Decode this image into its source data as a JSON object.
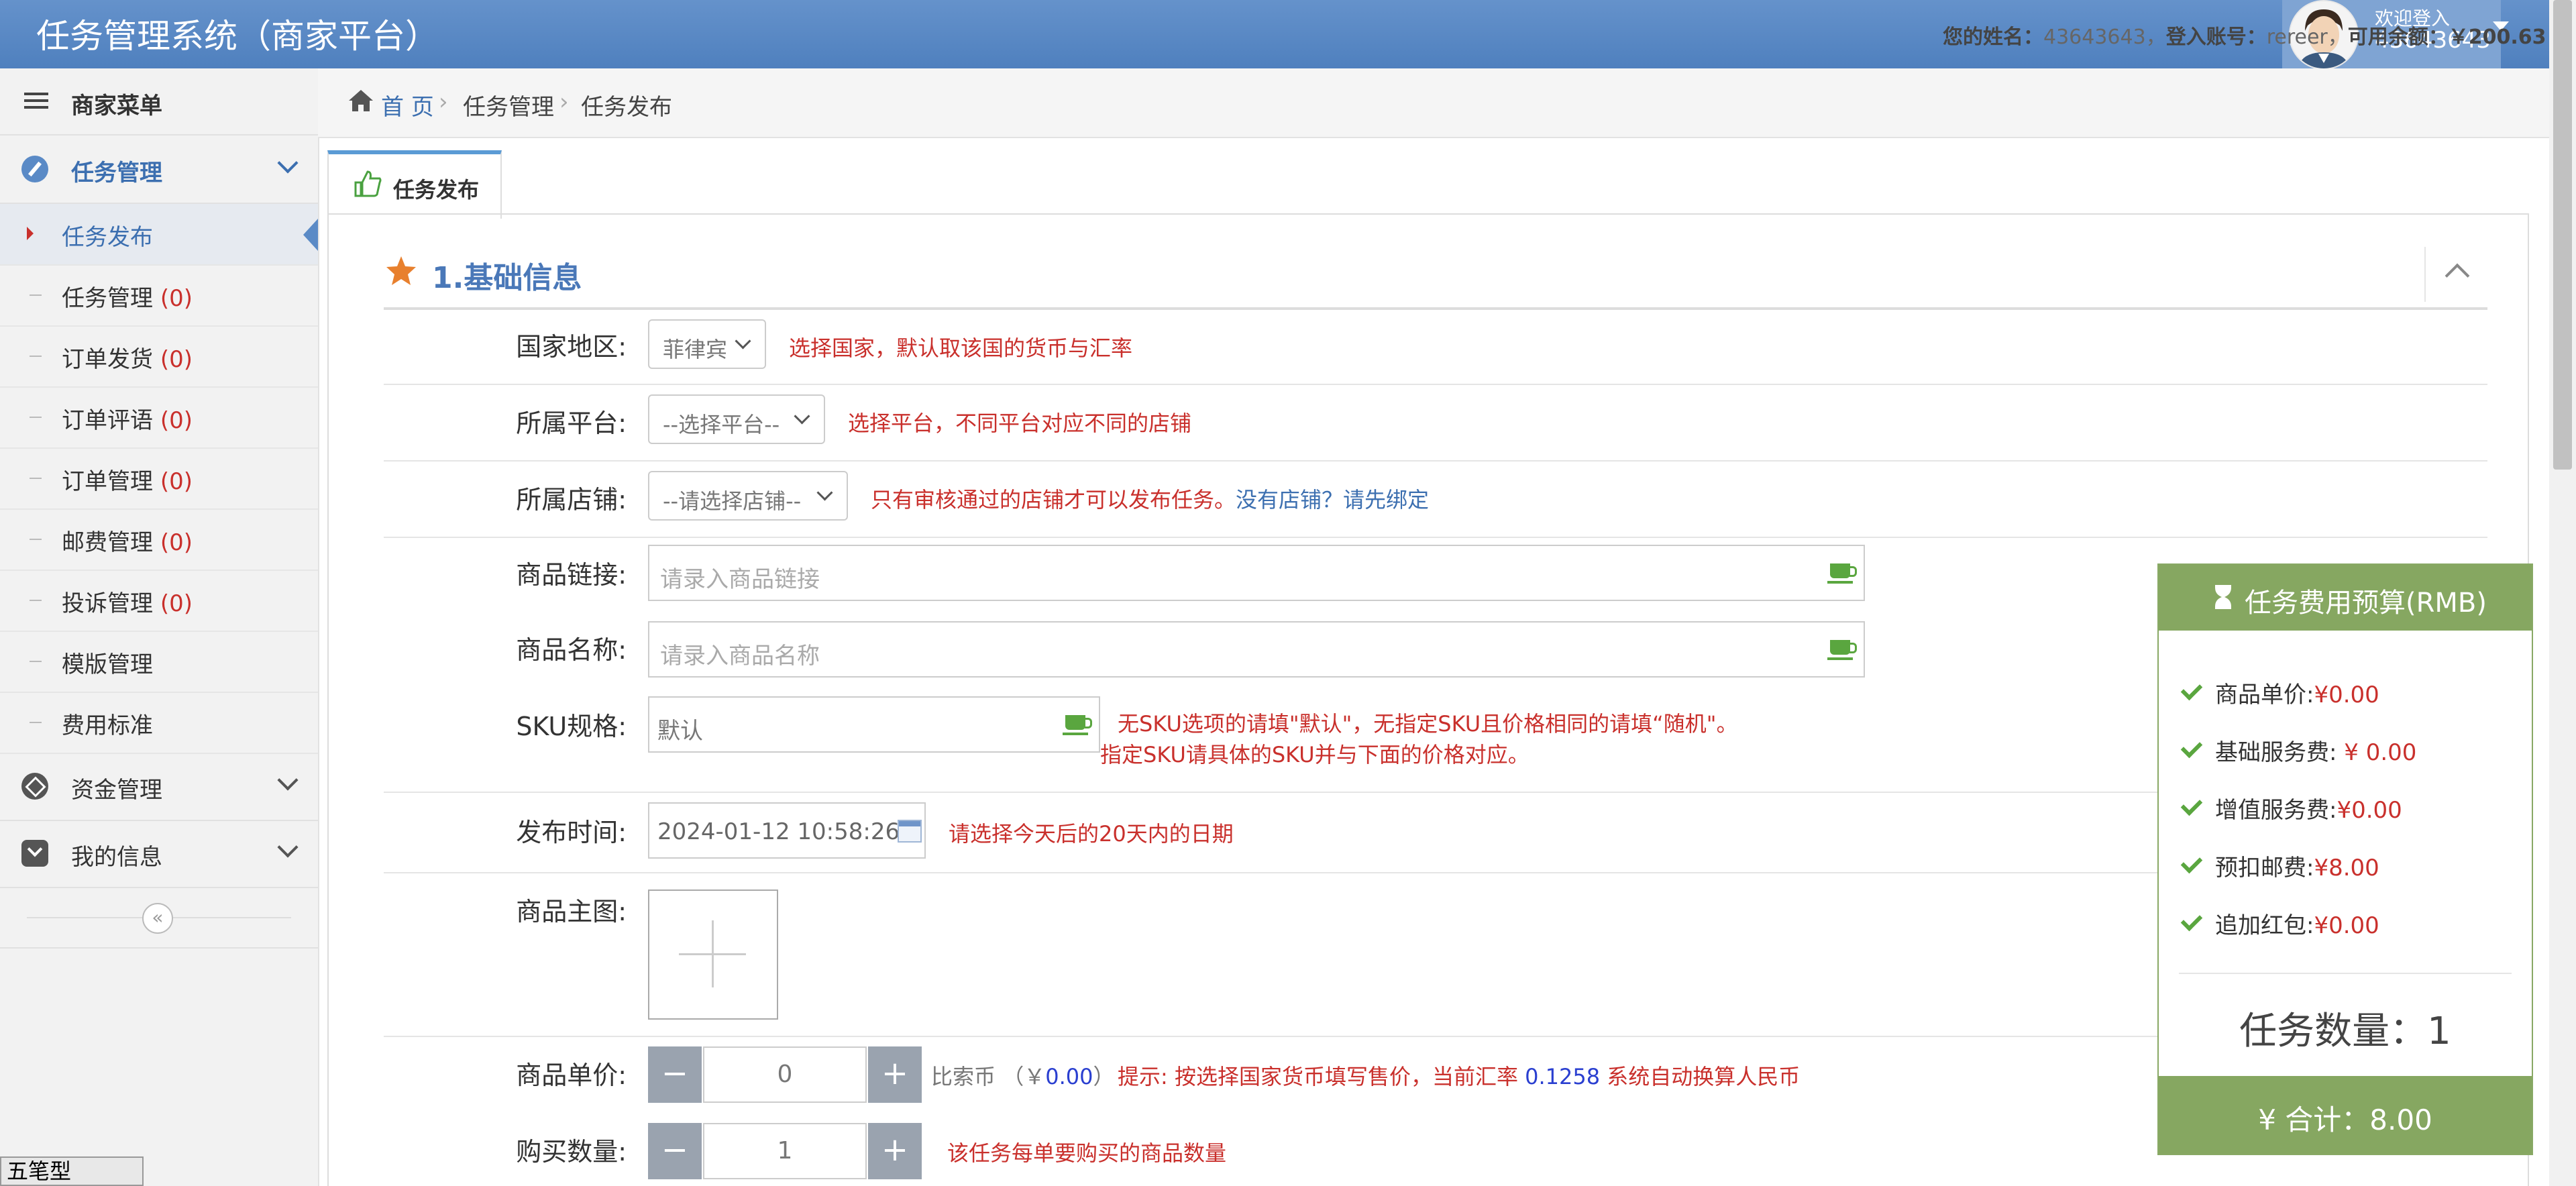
{
  "header": {
    "app_title": "任务管理系统（商家平台）",
    "welcome": "欢迎登入",
    "user_id": "43643643"
  },
  "sidebar": {
    "menu_title": "商家菜单",
    "groups": [
      {
        "label": "任务管理"
      },
      {
        "label": "资金管理"
      },
      {
        "label": "我的信息"
      }
    ],
    "items": [
      {
        "label": "任务发布",
        "count": ""
      },
      {
        "label": "任务管理",
        "count": "(0)"
      },
      {
        "label": "订单发货",
        "count": "(0)"
      },
      {
        "label": "订单评语",
        "count": "(0)"
      },
      {
        "label": "订单管理",
        "count": "(0)"
      },
      {
        "label": "邮费管理",
        "count": "(0)"
      },
      {
        "label": "投诉管理",
        "count": "(0)"
      },
      {
        "label": "模版管理",
        "count": ""
      },
      {
        "label": "费用标准",
        "count": ""
      }
    ]
  },
  "breadcrumb": {
    "home": "首 页",
    "level1": "任务管理",
    "level2": "任务发布",
    "sep": "›"
  },
  "account": {
    "name_label": "您的姓名：",
    "name": "43643643，",
    "login_label": "登入账号：",
    "login": "rereer，",
    "balance_label": "可用余额：",
    "balance": "￥200.63"
  },
  "tab": {
    "label": "任务发布"
  },
  "section": {
    "title": "1.基础信息"
  },
  "form": {
    "country": {
      "label": "国家地区:",
      "value": "菲律宾",
      "hint": "选择国家，默认取该国的货币与汇率"
    },
    "platform": {
      "label": "所属平台:",
      "value": "--选择平台--",
      "hint": "选择平台，不同平台对应不同的店铺"
    },
    "shop": {
      "label": "所属店铺:",
      "value": "--请选择店铺--",
      "hint": "只有审核通过的店铺才可以发布任务。",
      "link": "没有店铺？请先绑定"
    },
    "link": {
      "label": "商品链接:",
      "placeholder": "请录入商品链接"
    },
    "name": {
      "label": "商品名称:",
      "placeholder": "请录入商品名称"
    },
    "sku": {
      "label": "SKU规格:",
      "placeholder": "默认",
      "hint1": "无SKU选项的请填\"默认\"，无指定SKU且价格相同的请填“随机\"。",
      "hint2": "指定SKU请具体的SKU并与下面的价格对应。"
    },
    "time": {
      "label": "发布时间:",
      "value": "2024-01-12 10:58:26",
      "hint": "请选择今天后的20天内的日期"
    },
    "image": {
      "label": "商品主图:"
    },
    "price": {
      "label": "商品单价:",
      "value": "0",
      "currency": "比索币",
      "rmb_prefix": "（￥",
      "rmb": "0.00",
      "rmb_suffix": "）",
      "hint_a": "提示: 按选择国家货币填写售价，当前汇率",
      "rate": "0.1258",
      "hint_b": "系统自动换算人民币"
    },
    "qty": {
      "label": "购买数量:",
      "value": "1",
      "hint": "该任务每单要购买的商品数量"
    }
  },
  "budget": {
    "title": "任务费用预算(RMB)",
    "items": [
      {
        "label": "商品单价:",
        "value": "¥0.00"
      },
      {
        "label": "基础服务费:",
        "value": " ¥ 0.00"
      },
      {
        "label": "增值服务费:",
        "value": "¥0.00"
      },
      {
        "label": "预扣邮费:",
        "value": "¥8.00"
      },
      {
        "label": "追加红包:",
        "value": "¥0.00"
      }
    ],
    "count": "任务数量：1",
    "total": "¥  合计：8.00"
  },
  "ime": {
    "label": "五笔型"
  }
}
